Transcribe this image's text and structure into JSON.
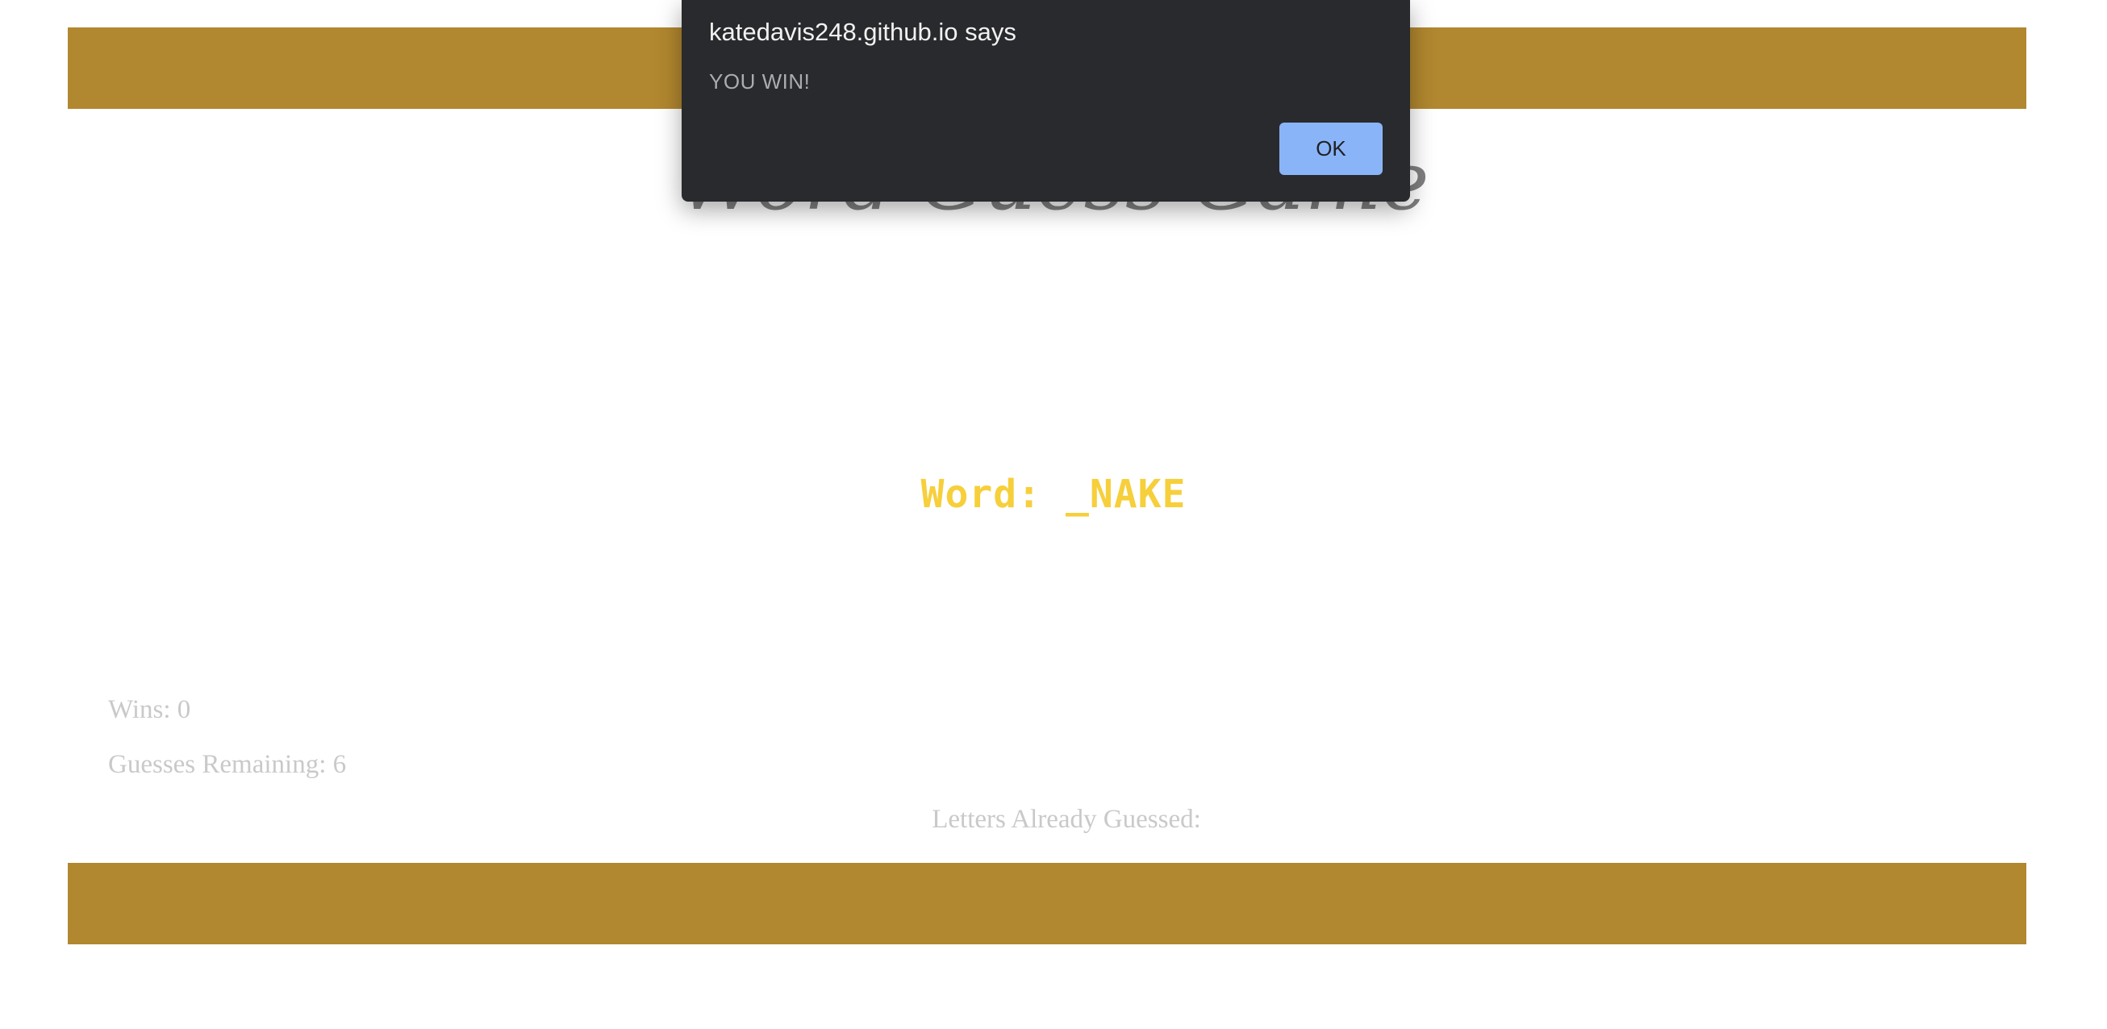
{
  "page": {
    "title": "Word Guess Game",
    "word_label": "Word: _NAKE",
    "wins_label": "Wins: 0",
    "guesses_label": "Guesses Remaining: 6",
    "letters_label": "Letters Already Guessed:"
  },
  "dialog": {
    "title": "katedavis248.github.io says",
    "message": "YOU WIN!",
    "ok_label": "OK"
  },
  "colors": {
    "band": "#b1872f",
    "word": "#f6cf3b",
    "title": "#808080",
    "stats": "#c9c9c9",
    "dialog_bg": "#292a2d",
    "ok_button": "#8ab4f8"
  }
}
